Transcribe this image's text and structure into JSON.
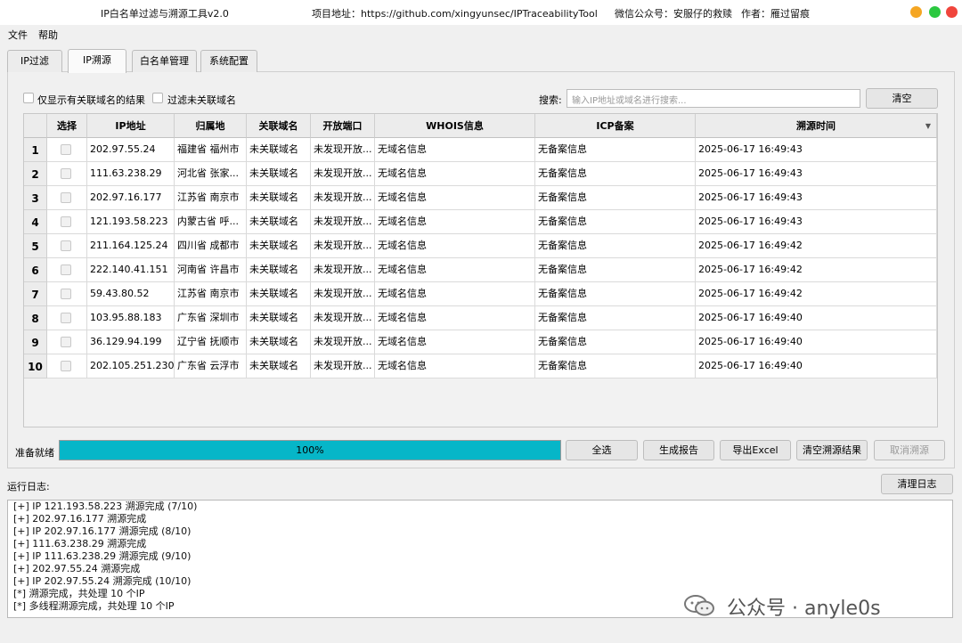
{
  "window": {
    "app_title": "IP白名单过滤与溯源工具v2.0",
    "project": "项目地址：https://github.com/xingyunsec/IPTraceabilityTool",
    "wechat": "微信公众号：安服仔的救赎",
    "author": "作者：雁过留痕"
  },
  "menu": {
    "file": "文件",
    "help": "帮助"
  },
  "tabs": [
    "IP过滤",
    "IP溯源",
    "白名单管理",
    "系统配置"
  ],
  "filters": {
    "only_related": "仅显示有关联域名的结果",
    "filter_unrelated": "过滤未关联域名",
    "search_label": "搜索:",
    "search_placeholder": "输入IP地址或域名进行搜索...",
    "clear": "清空"
  },
  "table": {
    "headers": [
      "选择",
      "IP地址",
      "归属地",
      "关联域名",
      "开放端口",
      "WHOIS信息",
      "ICP备案",
      "溯源时间"
    ],
    "rows": [
      {
        "n": "1",
        "ip": "202.97.55.24",
        "loc": "福建省 福州市",
        "domain": "未关联域名",
        "port": "未发现开放...",
        "whois": "无域名信息",
        "icp": "无备案信息",
        "time": "2025-06-17 16:49:43"
      },
      {
        "n": "2",
        "ip": "111.63.238.29",
        "loc": "河北省 张家...",
        "domain": "未关联域名",
        "port": "未发现开放...",
        "whois": "无域名信息",
        "icp": "无备案信息",
        "time": "2025-06-17 16:49:43"
      },
      {
        "n": "3",
        "ip": "202.97.16.177",
        "loc": "江苏省 南京市",
        "domain": "未关联域名",
        "port": "未发现开放...",
        "whois": "无域名信息",
        "icp": "无备案信息",
        "time": "2025-06-17 16:49:43"
      },
      {
        "n": "4",
        "ip": "121.193.58.223",
        "loc": "内蒙古省 呼...",
        "domain": "未关联域名",
        "port": "未发现开放...",
        "whois": "无域名信息",
        "icp": "无备案信息",
        "time": "2025-06-17 16:49:43"
      },
      {
        "n": "5",
        "ip": "211.164.125.24",
        "loc": "四川省 成都市",
        "domain": "未关联域名",
        "port": "未发现开放...",
        "whois": "无域名信息",
        "icp": "无备案信息",
        "time": "2025-06-17 16:49:42"
      },
      {
        "n": "6",
        "ip": "222.140.41.151",
        "loc": "河南省 许昌市",
        "domain": "未关联域名",
        "port": "未发现开放...",
        "whois": "无域名信息",
        "icp": "无备案信息",
        "time": "2025-06-17 16:49:42"
      },
      {
        "n": "7",
        "ip": "59.43.80.52",
        "loc": "江苏省 南京市",
        "domain": "未关联域名",
        "port": "未发现开放...",
        "whois": "无域名信息",
        "icp": "无备案信息",
        "time": "2025-06-17 16:49:42"
      },
      {
        "n": "8",
        "ip": "103.95.88.183",
        "loc": "广东省 深圳市",
        "domain": "未关联域名",
        "port": "未发现开放...",
        "whois": "无域名信息",
        "icp": "无备案信息",
        "time": "2025-06-17 16:49:40"
      },
      {
        "n": "9",
        "ip": "36.129.94.199",
        "loc": "辽宁省 抚顺市",
        "domain": "未关联域名",
        "port": "未发现开放...",
        "whois": "无域名信息",
        "icp": "无备案信息",
        "time": "2025-06-17 16:49:40"
      },
      {
        "n": "10",
        "ip": "202.105.251.230",
        "loc": "广东省 云浮市",
        "domain": "未关联域名",
        "port": "未发现开放...",
        "whois": "无域名信息",
        "icp": "无备案信息",
        "time": "2025-06-17 16:49:40"
      }
    ]
  },
  "status": {
    "ready": "准备就绪",
    "progress_value": 1.0,
    "progress_text": "100%",
    "select_all": "全选",
    "report": "生成报告",
    "export": "导出Excel",
    "clear_results": "清空溯源结果",
    "cancel": "取消溯源"
  },
  "log": {
    "title": "运行日志:",
    "clear": "清理日志",
    "lines": [
      "[+] IP 121.193.58.223 溯源完成 (7/10)",
      "[+] 202.97.16.177 溯源完成",
      "[+] IP 202.97.16.177 溯源完成 (8/10)",
      "[+] 111.63.238.29 溯源完成",
      "[+] IP 111.63.238.29 溯源完成 (9/10)",
      "[+] 202.97.55.24 溯源完成",
      "[+] IP 202.97.55.24 溯源完成 (10/10)",
      "[*] 溯源完成，共处理 10 个IP",
      "[*] 多线程溯源完成，共处理 10 个IP"
    ]
  },
  "watermark": {
    "text": "公众号 · anyle0s",
    "icon": "wechat-icon"
  },
  "colors": {
    "progress": "#06b6c8",
    "win_min": "#f5a623",
    "win_max": "#2bc840",
    "win_close": "#f0453c"
  }
}
